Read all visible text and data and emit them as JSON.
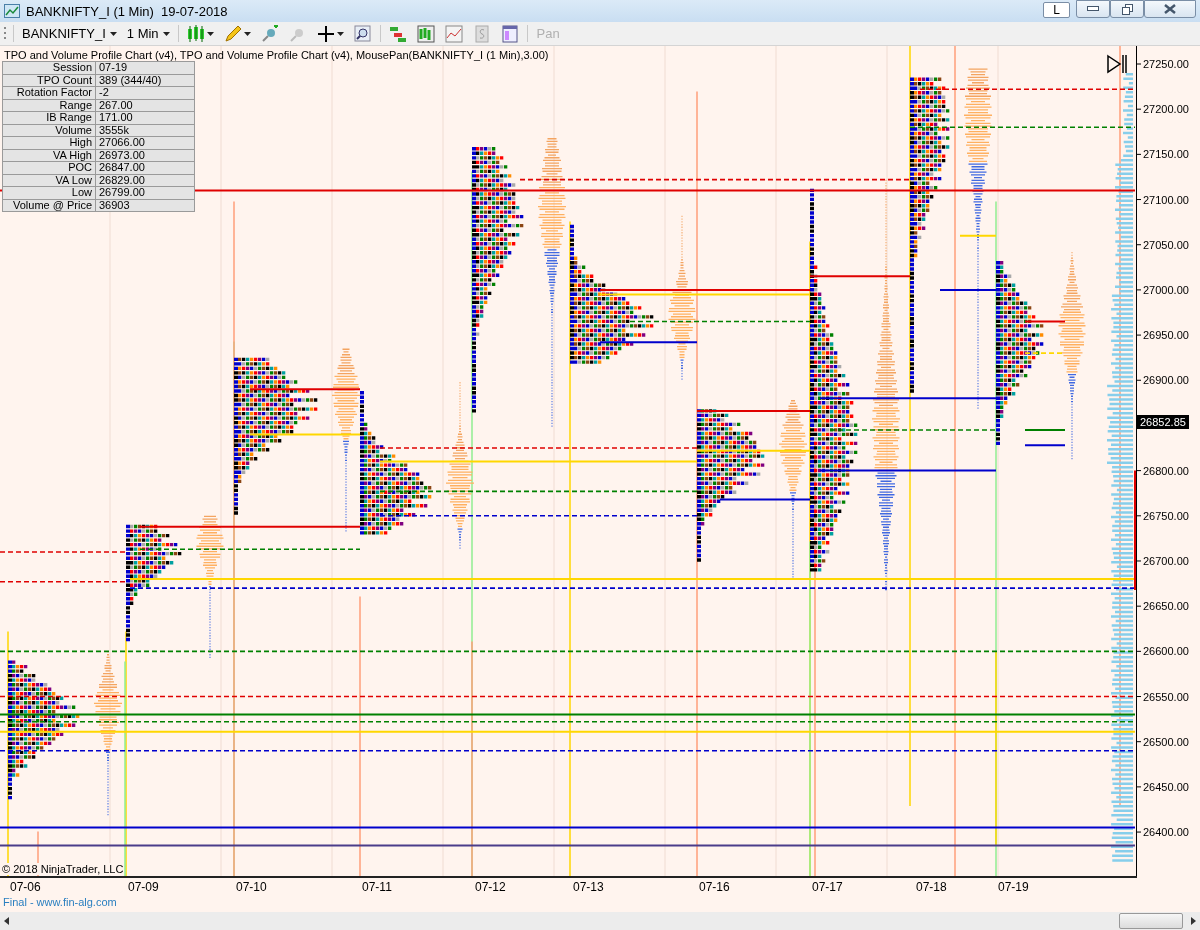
{
  "window": {
    "title": "BANKNIFTY_I (1 Min)  19-07-2018",
    "mode_button": "L"
  },
  "toolbar": {
    "instrument": "BANKNIFTY_I",
    "interval": "1 Min",
    "pan": {
      "label": "Pan",
      "disabled": true
    }
  },
  "chart": {
    "indicator_label": "TPO and Volume Profile Chart (v4),  TPO and Volume Profile Chart (v4), MousePan(BANKNIFTY_I (1 Min),3.00)",
    "info_table": [
      {
        "label": "Session",
        "value": "07-19"
      },
      {
        "label": "TPO Count",
        "value": "389 (344/40)"
      },
      {
        "label": "Rotation Factor",
        "value": "-2"
      },
      {
        "label": "Range",
        "value": "267.00"
      },
      {
        "label": "IB Range",
        "value": "171.00"
      },
      {
        "label": "Volume",
        "value": "3555k"
      },
      {
        "label": "High",
        "value": "27066.00"
      },
      {
        "label": "VA High",
        "value": "26973.00"
      },
      {
        "label": "POC",
        "value": "26847.00"
      },
      {
        "label": "VA Low",
        "value": "26829.00"
      },
      {
        "label": "Low",
        "value": "26799.00"
      },
      {
        "label": "Volume @ Price",
        "value": "36903"
      }
    ],
    "price_axis": {
      "labels": [
        "27250.00",
        "27200.00",
        "27150.00",
        "27100.00",
        "27050.00",
        "27000.00",
        "26950.00",
        "26900.00",
        "26800.00",
        "26750.00",
        "26700.00",
        "26650.00",
        "26600.00",
        "26550.00",
        "26500.00",
        "26450.00",
        "26400.00"
      ],
      "last_price": "26852.85"
    },
    "time_axis": {
      "labels": [
        "07-06",
        "07-09",
        "07-10",
        "07-11",
        "07-12",
        "07-13",
        "07-16",
        "07-17",
        "07-18",
        "07-19"
      ]
    },
    "copyright": "© 2018 NinjaTrader, LLC"
  },
  "footer": "Final - www.fin-alg.com"
}
